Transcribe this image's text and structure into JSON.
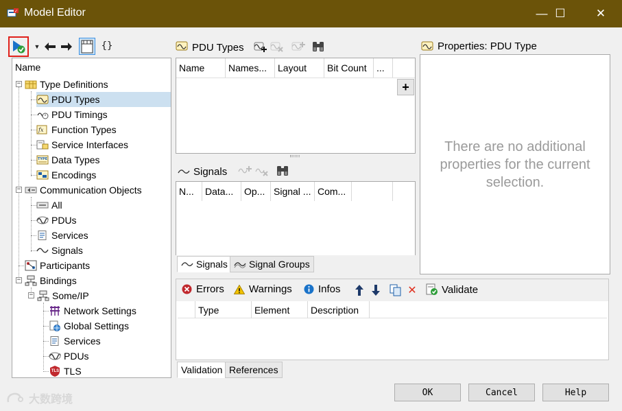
{
  "window": {
    "title": "Model Editor",
    "minimize_icon": "—",
    "maximize_icon": "☐",
    "close_icon": "✕"
  },
  "toolbar": {
    "json_label": "{}"
  },
  "tree": {
    "header": "Name",
    "items": [
      {
        "label": "Type Definitions"
      },
      {
        "label": "PDU Types"
      },
      {
        "label": "PDU Timings"
      },
      {
        "label": "Function Types"
      },
      {
        "label": "Service Interfaces"
      },
      {
        "label": "Data Types"
      },
      {
        "label": "Encodings"
      },
      {
        "label": "Communication Objects"
      },
      {
        "label": "All"
      },
      {
        "label": "PDUs"
      },
      {
        "label": "Services"
      },
      {
        "label": "Signals"
      },
      {
        "label": "Participants"
      },
      {
        "label": "Bindings"
      },
      {
        "label": "Some/IP"
      },
      {
        "label": "Network Settings"
      },
      {
        "label": "Global Settings"
      },
      {
        "label": "Services"
      },
      {
        "label": "PDUs"
      },
      {
        "label": "TLS"
      }
    ],
    "tls_badge": "TLS"
  },
  "pdu_types": {
    "title": "PDU Types",
    "columns": [
      "Name",
      "Names...",
      "Layout",
      "Bit Count",
      "..."
    ],
    "add_label": "+"
  },
  "signals": {
    "title": "Signals",
    "columns": [
      "N...",
      "Data...",
      "Op...",
      "Signal ...",
      "Com..."
    ],
    "tabs": [
      "Signals",
      "Signal Groups"
    ]
  },
  "properties": {
    "title": "Properties: PDU Type",
    "empty_message": "There are no additional properties for the current selection."
  },
  "validation": {
    "errors_label": "Errors",
    "warnings_label": "Warnings",
    "infos_label": "Infos",
    "validate_label": "Validate",
    "columns": [
      "Type",
      "Element",
      "Description"
    ],
    "tabs": [
      "Validation",
      "References"
    ]
  },
  "buttons": {
    "ok": "OK",
    "cancel": "Cancel",
    "help": "Help"
  },
  "watermark": "大数跨境",
  "colors": {
    "titlebar": "#6b5309",
    "selection": "#cce0f0",
    "error": "#c0282d",
    "warning": "#f2c200",
    "info": "#1a73c9",
    "ok_green": "#2e9e3a"
  }
}
